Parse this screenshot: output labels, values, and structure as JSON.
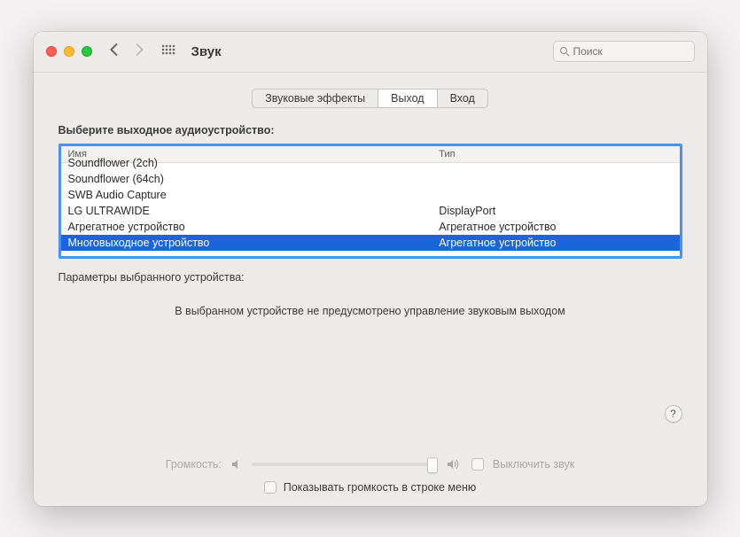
{
  "window": {
    "title": "Звук",
    "search_placeholder": "Поиск"
  },
  "tabs": {
    "effects": "Звуковые эффекты",
    "output": "Выход",
    "input": "Вход",
    "active": "output"
  },
  "section": {
    "choose_label": "Выберите выходное аудиоустройство:",
    "col_name": "Имя",
    "col_type": "Тип"
  },
  "devices": [
    {
      "name": "Soundflower (2ch)",
      "type": "",
      "clipped": true
    },
    {
      "name": "Soundflower (64ch)",
      "type": ""
    },
    {
      "name": "SWB Audio Capture",
      "type": ""
    },
    {
      "name": "LG ULTRAWIDE",
      "type": "DisplayPort"
    },
    {
      "name": "Агрегатное устройство",
      "type": "Агрегатное устройство"
    },
    {
      "name": "Многовыходное устройство",
      "type": "Агрегатное устройство",
      "selected": true
    }
  ],
  "params": {
    "label": "Параметры выбранного устройства:",
    "no_controls": "В выбранном устройстве не предусмотрено управление звуковым выходом"
  },
  "volume": {
    "label": "Громкость:",
    "mute_label": "Выключить звук"
  },
  "menubar": {
    "show_label": "Показывать громкость в строке меню"
  },
  "help": "?"
}
